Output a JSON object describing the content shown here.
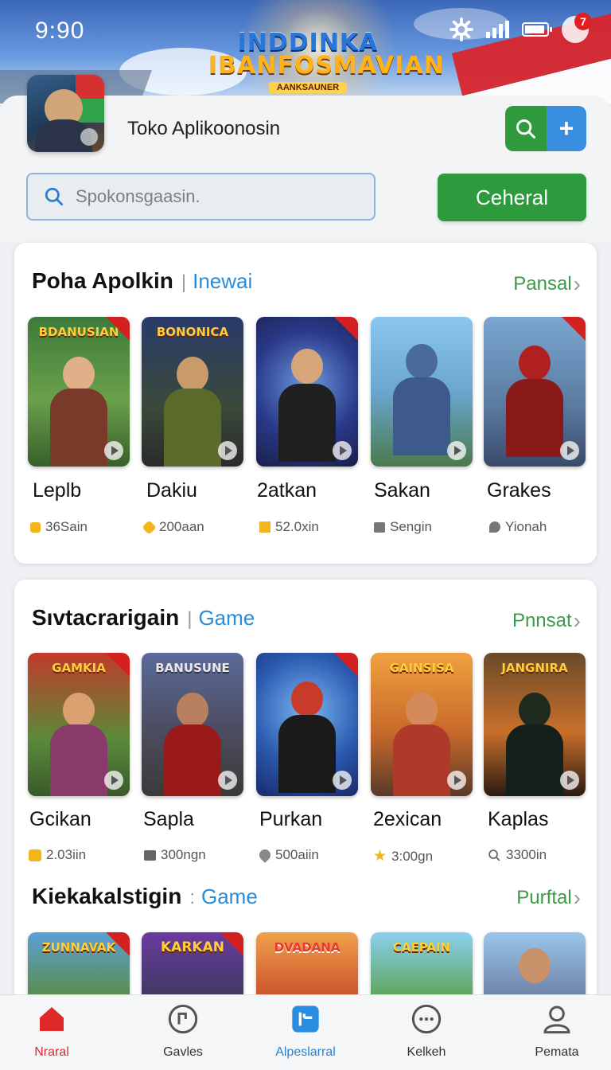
{
  "status_bar": {
    "time": "9:90",
    "notification_count": "7"
  },
  "banner": {
    "logo_line1": "INDDINKA",
    "logo_line2": "IBANFOSMAVIAN",
    "logo_line3": "AANKSAUNER"
  },
  "header": {
    "store_title": "Toko Aplikoonosin",
    "search_placeholder": "Spokonsgaasin.",
    "green_button": "Ceheral",
    "add_button": "+"
  },
  "sections": [
    {
      "title": "Poha Apolkin",
      "category": "Inewai",
      "link": "Pansal",
      "apps": [
        {
          "name": "Leplb",
          "meta": "36Sain",
          "logo": "BDANUSIAN"
        },
        {
          "name": "Dakiu",
          "meta": "200aan",
          "logo": "BONONICA"
        },
        {
          "name": "2atkan",
          "meta": "52.0xin",
          "logo": ""
        },
        {
          "name": "Sakan",
          "meta": "Sengin",
          "logo": ""
        },
        {
          "name": "Grakes",
          "meta": "Yionah",
          "logo": ""
        }
      ]
    },
    {
      "title": "Sıvtacrarigain",
      "category": "Game",
      "link": "Pnnsat",
      "apps": [
        {
          "name": "Gcikan",
          "meta": "2.03iin",
          "logo": "GAMKIA"
        },
        {
          "name": "Sapla",
          "meta": "300ngn",
          "logo": "BANUSUNE"
        },
        {
          "name": "Purkan",
          "meta": "500aiin",
          "logo": ""
        },
        {
          "name": "2exican",
          "meta": "3:00gn",
          "logo": "GAINSISA"
        },
        {
          "name": "Kaplas",
          "meta": "3300in",
          "logo": "JANGNIRA"
        }
      ]
    },
    {
      "title": "Kiekakalstigin",
      "category": "Game",
      "link": "Purftal",
      "apps": [
        {
          "name": "",
          "meta": "",
          "logo": "ZUNNAVAK"
        },
        {
          "name": "",
          "meta": "",
          "logo": "KARKAN"
        },
        {
          "name": "",
          "meta": "",
          "logo": "DVADANA"
        },
        {
          "name": "",
          "meta": "",
          "logo": "CAEPAIN"
        },
        {
          "name": "",
          "meta": "",
          "logo": ""
        }
      ]
    }
  ],
  "bottom_nav": [
    {
      "label": "Nraral",
      "icon": "home-icon"
    },
    {
      "label": "Gavles",
      "icon": "games-icon"
    },
    {
      "label": "Alpeslarral",
      "icon": "apps-icon"
    },
    {
      "label": "Kelkeh",
      "icon": "chat-icon"
    },
    {
      "label": "Pemata",
      "icon": "profile-icon"
    }
  ],
  "colors": {
    "accent_green": "#2e9a3e",
    "accent_blue": "#2a8bd6",
    "active_red": "#e02a2a"
  }
}
